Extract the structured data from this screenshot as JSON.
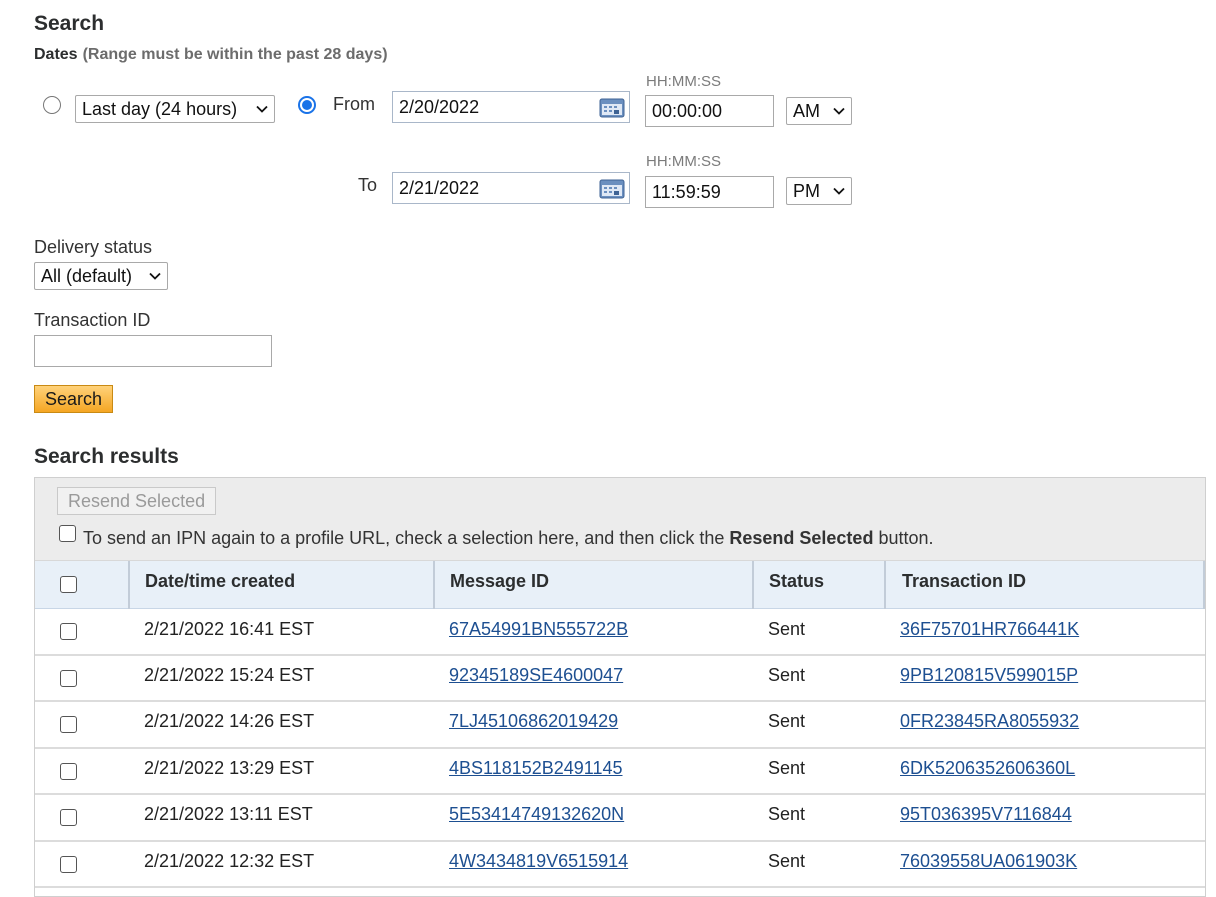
{
  "search": {
    "heading": "Search",
    "dates_label": "Dates",
    "dates_note": "(Range must be within the past 28 days)",
    "range_option": "Last day (24 hours)",
    "from_label": "From",
    "to_label": "To",
    "from_date": "2/20/2022",
    "to_date": "2/21/2022",
    "time_format_hint": "HH:MM:SS",
    "from_time": "00:00:00",
    "to_time": "11:59:59",
    "from_ampm": "AM",
    "to_ampm": "PM",
    "delivery_status_label": "Delivery status",
    "delivery_status_value": "All (default)",
    "transaction_id_label": "Transaction ID",
    "transaction_id_value": "",
    "search_button": "Search"
  },
  "results": {
    "heading": "Search results",
    "resend_button": "Resend Selected",
    "note_prefix": "To send an IPN again to a profile URL, check a selection here, and then click the ",
    "note_bold": "Resend Selected",
    "note_suffix": " button.",
    "columns": [
      "Date/time created",
      "Message ID",
      "Status",
      "Transaction ID"
    ],
    "rows": [
      {
        "date": "2/21/2022 16:41 EST",
        "message_id": "67A54991BN555722B",
        "status": "Sent",
        "transaction_id": "36F75701HR766441K"
      },
      {
        "date": "2/21/2022 15:24 EST",
        "message_id": "92345189SE4600047",
        "status": "Sent",
        "transaction_id": "9PB120815V599015P"
      },
      {
        "date": "2/21/2022 14:26 EST",
        "message_id": "7LJ45106862019429",
        "status": "Sent",
        "transaction_id": "0FR23845RA8055932"
      },
      {
        "date": "2/21/2022 13:29 EST",
        "message_id": "4BS118152B2491145",
        "status": "Sent",
        "transaction_id": "6DK5206352606360L"
      },
      {
        "date": "2/21/2022 13:11 EST",
        "message_id": "5E53414749132620N",
        "status": "Sent",
        "transaction_id": "95T036395V7116844"
      },
      {
        "date": "2/21/2022 12:32 EST",
        "message_id": "4W3434819V6515914",
        "status": "Sent",
        "transaction_id": "76039558UA061903K"
      }
    ]
  },
  "colors": {
    "accent": "#1a73e8",
    "link": "#1d4f91",
    "search_button": "#f5a623",
    "table_header": "#e8f0f8"
  }
}
